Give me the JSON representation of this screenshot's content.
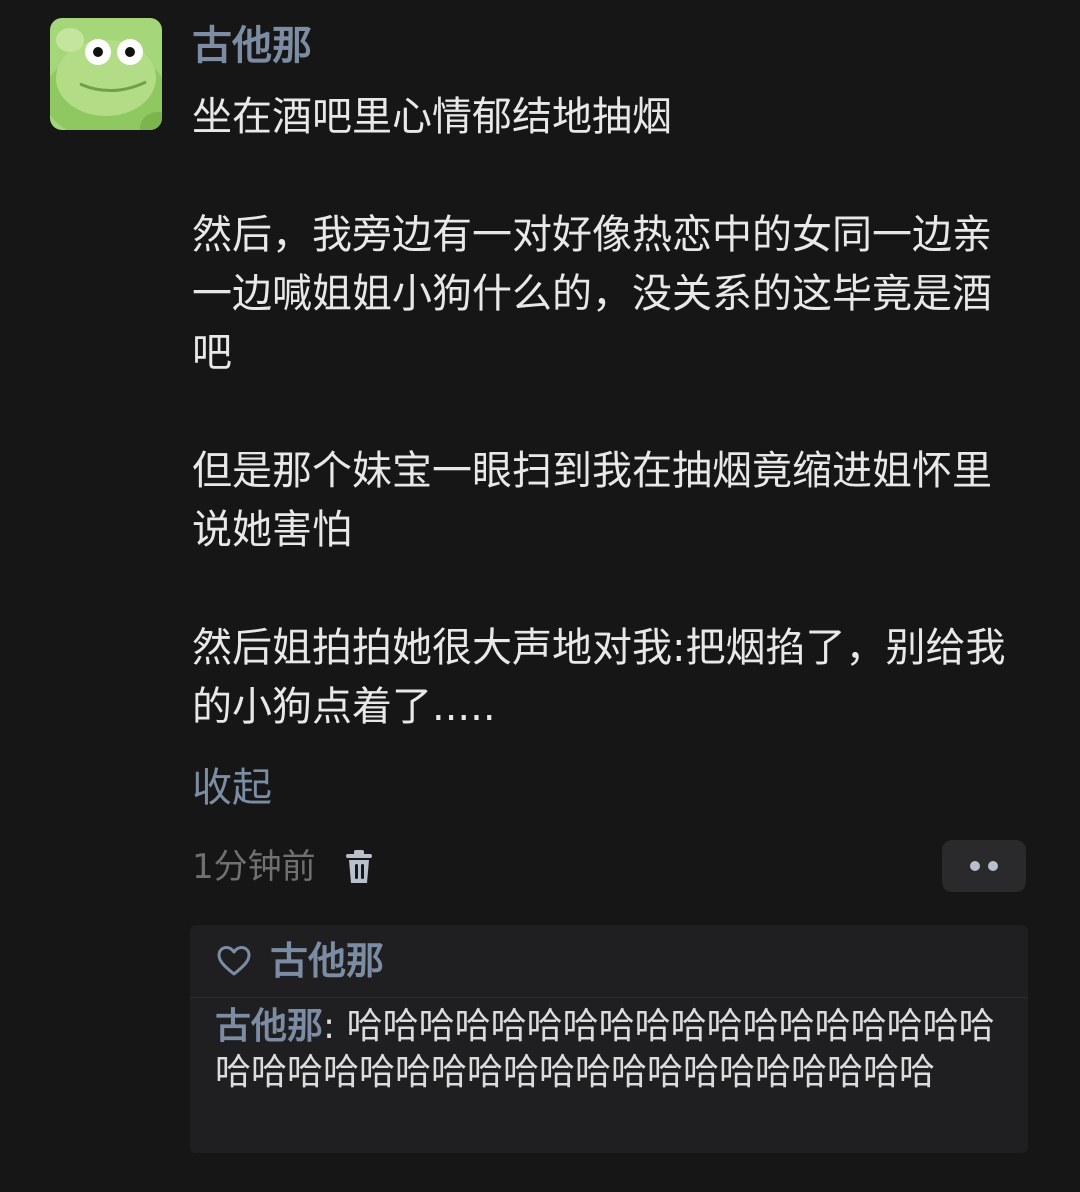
{
  "post": {
    "author": "古他那",
    "avatar_icon": "frog-avatar-icon",
    "paragraphs": [
      "坐在酒吧里心情郁结地抽烟",
      "然后，我旁边有一对好像热恋中的女同一边亲一边喊姐姐小狗什么的，没关系的这毕竟是酒吧",
      "但是那个妹宝一眼扫到我在抽烟竟缩进姐怀里说她害怕",
      "然后姐拍拍她很大声地对我:把烟掐了，别给我的小狗点着了....."
    ],
    "collapse_label": "收起",
    "timestamp": "1分钟前",
    "delete_icon": "trash-icon",
    "more_icon": "more-dots-icon"
  },
  "interactions": {
    "like_icon": "heart-icon",
    "liked_by": "古他那",
    "reply": {
      "author": "古他那",
      "separator": ": ",
      "text": "哈哈哈哈哈哈哈哈哈哈哈哈哈哈哈哈哈哈哈哈哈哈哈哈哈哈哈哈哈哈哈哈哈哈哈哈哈哈"
    }
  },
  "colors": {
    "background": "#161616",
    "accent_name": "#7c8da3",
    "text": "#e8e8e8",
    "muted": "#707070"
  }
}
